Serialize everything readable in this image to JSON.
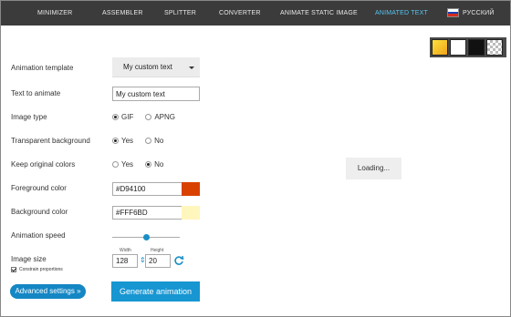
{
  "nav": {
    "items": [
      "MINIMIZER",
      "ASSEMBLER",
      "SPLITTER",
      "CONVERTER",
      "ANIMATE STATIC IMAGE",
      "ANIMATED TEXT"
    ],
    "active_index": 5,
    "language": "РУССКИЙ"
  },
  "swatches": [
    "gradient-yellow",
    "white",
    "black",
    "transparent-checker"
  ],
  "form": {
    "template_label": "Animation template",
    "template_value": "My custom text",
    "text_label": "Text to animate",
    "text_value": "My custom text",
    "image_type_label": "Image type",
    "image_type_options": [
      "GIF",
      "APNG"
    ],
    "image_type_selected": "GIF",
    "transparent_label": "Transparent background",
    "transparent_options": [
      "Yes",
      "No"
    ],
    "transparent_selected": "Yes",
    "keep_colors_label": "Keep original colors",
    "keep_colors_options": [
      "Yes",
      "No"
    ],
    "keep_colors_selected": "No",
    "fg_label": "Foreground color",
    "fg_value": "#D94100",
    "bg_label": "Background color",
    "bg_value": "#FFF6BD",
    "speed_label": "Animation speed",
    "speed_level": 0.48,
    "size_label": "Image size",
    "width_label": "Width",
    "height_label": "Height",
    "width_value": "128",
    "height_value": "20",
    "constrain_label": "Constrain proportions",
    "constrain_checked": true
  },
  "buttons": {
    "advanced": "Advanced settings »",
    "generate": "Generate animation"
  },
  "preview": {
    "loading": "Loading..."
  },
  "colors": {
    "nav_bg": "#3b3b3b",
    "nav_active": "#55c6f2",
    "accent": "#1796d2",
    "foreground_chip": "#D94100",
    "background_chip": "#FFF6BD"
  }
}
